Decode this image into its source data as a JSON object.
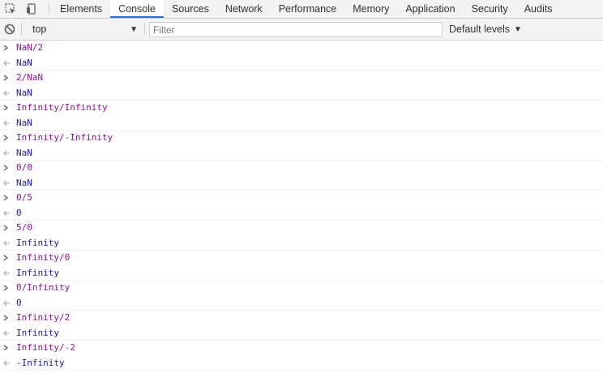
{
  "tabs": [
    {
      "label": "Elements",
      "active": false
    },
    {
      "label": "Console",
      "active": true
    },
    {
      "label": "Sources",
      "active": false
    },
    {
      "label": "Network",
      "active": false
    },
    {
      "label": "Performance",
      "active": false
    },
    {
      "label": "Memory",
      "active": false
    },
    {
      "label": "Application",
      "active": false
    },
    {
      "label": "Security",
      "active": false
    },
    {
      "label": "Audits",
      "active": false
    }
  ],
  "toolbar": {
    "context": "top",
    "filter_placeholder": "Filter",
    "filter_value": "",
    "levels_label": "Default levels"
  },
  "colors": {
    "command": "#881391",
    "result": "#1a1aa6",
    "accent": "#1a73e8"
  },
  "console": [
    {
      "input": "NaN/2",
      "output": "NaN"
    },
    {
      "input": "2/NaN",
      "output": "NaN"
    },
    {
      "input": "Infinity/Infinity",
      "output": "NaN"
    },
    {
      "input": "Infinity/-Infinity",
      "output": "NaN"
    },
    {
      "input": "0/0",
      "output": "NaN"
    },
    {
      "input": "0/5",
      "output": "0"
    },
    {
      "input": "5/0",
      "output": "Infinity"
    },
    {
      "input": "Infinity/0",
      "output": "Infinity"
    },
    {
      "input": "0/Infinity",
      "output": "0"
    },
    {
      "input": "Infinity/2",
      "output": "Infinity"
    },
    {
      "input": "Infinity/-2",
      "output": "-Infinity"
    }
  ]
}
